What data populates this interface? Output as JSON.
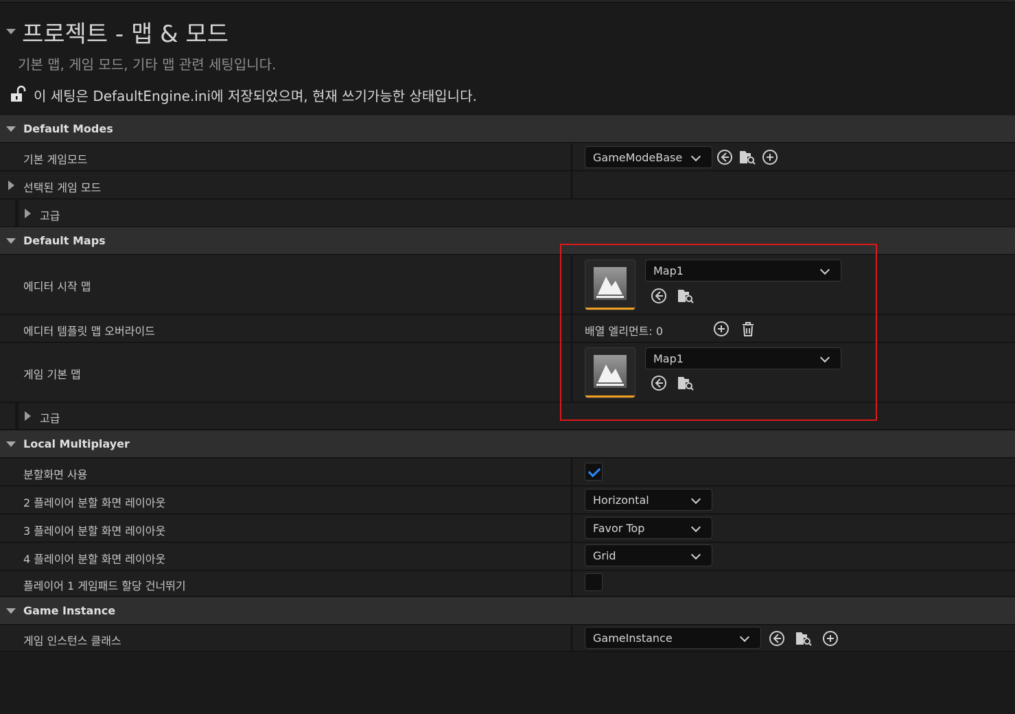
{
  "header": {
    "title": "프로젝트 - 맵 & 모드",
    "description": "기본 맵, 게임 모드, 기타 맵 관련 세팅입니다.",
    "config_note": "이 세팅은 DefaultEngine.ini에 저장되었으며, 현재 쓰기가능한 상태입니다."
  },
  "default_modes": {
    "label": "Default Modes",
    "default_gamemode_label": "기본 게임모드",
    "default_gamemode_value": "GameModeBase",
    "selected_gamemode_label": "선택된 게임 모드",
    "advanced_label": "고급"
  },
  "default_maps": {
    "label": "Default Maps",
    "editor_startup_label": "에디터 시작 맵",
    "editor_startup_value": "Map1",
    "editor_template_label": "에디터 템플릿 맵 오버라이드",
    "array_elements": "배열 엘리먼트: 0",
    "game_default_label": "게임 기본 맵",
    "game_default_value": "Map1",
    "advanced_label": "고급"
  },
  "local_multiplayer": {
    "label": "Local Multiplayer",
    "splitscreen_label": "분할화면 사용",
    "splitscreen_checked": true,
    "two_player_label": "2 플레이어 분할 화면 레이아웃",
    "two_player_value": "Horizontal",
    "three_player_label": "3 플레이어 분할 화면 레이아웃",
    "three_player_value": "Favor Top",
    "four_player_label": "4 플레이어 분할 화면 레이아웃",
    "four_player_value": "Grid",
    "skip_gamepad_label": "플레이어 1 게임패드 할당 건너뛰기",
    "skip_gamepad_checked": false
  },
  "game_instance": {
    "label": "Game Instance",
    "class_label": "게임 인스턴스 클래스",
    "class_value": "GameInstance"
  },
  "colors": {
    "background": "#1a1a1a",
    "category_row": "#2f2f2f",
    "property_row": "#1f1f1f",
    "accent_orange": "#f0a020",
    "check_blue": "#2a8af6",
    "highlight_red": "#e01818"
  }
}
